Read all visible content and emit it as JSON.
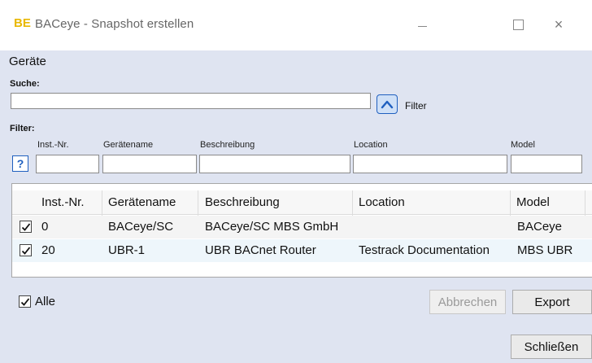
{
  "window": {
    "logo": "BE",
    "title": "BACeye - Snapshot erstellen",
    "minimize_icon": "minimize-icon",
    "maximize_icon": "maximize-icon",
    "close_glyph": "×"
  },
  "devices_section": {
    "title": "Geräte"
  },
  "search": {
    "label": "Suche:",
    "value": ""
  },
  "filter_toggle": {
    "icon": "chevron-up-icon",
    "label": "Filter"
  },
  "filter": {
    "label": "Filter:",
    "help_glyph": "?",
    "columns": [
      "Inst.-Nr.",
      "Gerätename",
      "Beschreibung",
      "Location",
      "Model"
    ]
  },
  "grid": {
    "columns": [
      "Inst.-Nr.",
      "Gerätename",
      "Beschreibung",
      "Location",
      "Model"
    ],
    "rows": [
      {
        "checked": true,
        "inst": "0",
        "name": "BACeye/SC",
        "description": "BACeye/SC MBS GmbH",
        "location": "",
        "model": "BACeye"
      },
      {
        "checked": true,
        "inst": "20",
        "name": "UBR-1",
        "description": "UBR BACnet Router",
        "location": "Testrack Documentation",
        "model": "MBS UBR"
      }
    ]
  },
  "footer": {
    "all_checked": true,
    "all_label": "Alle",
    "cancel_label": "Abbrechen",
    "export_label": "Export",
    "close_label": "Schließen"
  },
  "colors": {
    "window_bg": "#dfe4f1",
    "accent_blue": "#1f5fbf",
    "logo_yellow": "#e8b800"
  }
}
